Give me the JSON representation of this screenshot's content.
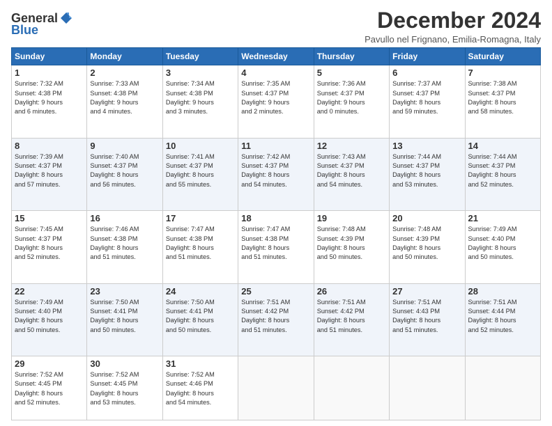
{
  "logo": {
    "general": "General",
    "blue": "Blue"
  },
  "title": "December 2024",
  "subtitle": "Pavullo nel Frignano, Emilia-Romagna, Italy",
  "headers": [
    "Sunday",
    "Monday",
    "Tuesday",
    "Wednesday",
    "Thursday",
    "Friday",
    "Saturday"
  ],
  "weeks": [
    [
      {
        "day": "1",
        "info": "Sunrise: 7:32 AM\nSunset: 4:38 PM\nDaylight: 9 hours\nand 6 minutes."
      },
      {
        "day": "2",
        "info": "Sunrise: 7:33 AM\nSunset: 4:38 PM\nDaylight: 9 hours\nand 4 minutes."
      },
      {
        "day": "3",
        "info": "Sunrise: 7:34 AM\nSunset: 4:38 PM\nDaylight: 9 hours\nand 3 minutes."
      },
      {
        "day": "4",
        "info": "Sunrise: 7:35 AM\nSunset: 4:37 PM\nDaylight: 9 hours\nand 2 minutes."
      },
      {
        "day": "5",
        "info": "Sunrise: 7:36 AM\nSunset: 4:37 PM\nDaylight: 9 hours\nand 0 minutes."
      },
      {
        "day": "6",
        "info": "Sunrise: 7:37 AM\nSunset: 4:37 PM\nDaylight: 8 hours\nand 59 minutes."
      },
      {
        "day": "7",
        "info": "Sunrise: 7:38 AM\nSunset: 4:37 PM\nDaylight: 8 hours\nand 58 minutes."
      }
    ],
    [
      {
        "day": "8",
        "info": "Sunrise: 7:39 AM\nSunset: 4:37 PM\nDaylight: 8 hours\nand 57 minutes."
      },
      {
        "day": "9",
        "info": "Sunrise: 7:40 AM\nSunset: 4:37 PM\nDaylight: 8 hours\nand 56 minutes."
      },
      {
        "day": "10",
        "info": "Sunrise: 7:41 AM\nSunset: 4:37 PM\nDaylight: 8 hours\nand 55 minutes."
      },
      {
        "day": "11",
        "info": "Sunrise: 7:42 AM\nSunset: 4:37 PM\nDaylight: 8 hours\nand 54 minutes."
      },
      {
        "day": "12",
        "info": "Sunrise: 7:43 AM\nSunset: 4:37 PM\nDaylight: 8 hours\nand 54 minutes."
      },
      {
        "day": "13",
        "info": "Sunrise: 7:44 AM\nSunset: 4:37 PM\nDaylight: 8 hours\nand 53 minutes."
      },
      {
        "day": "14",
        "info": "Sunrise: 7:44 AM\nSunset: 4:37 PM\nDaylight: 8 hours\nand 52 minutes."
      }
    ],
    [
      {
        "day": "15",
        "info": "Sunrise: 7:45 AM\nSunset: 4:37 PM\nDaylight: 8 hours\nand 52 minutes."
      },
      {
        "day": "16",
        "info": "Sunrise: 7:46 AM\nSunset: 4:38 PM\nDaylight: 8 hours\nand 51 minutes."
      },
      {
        "day": "17",
        "info": "Sunrise: 7:47 AM\nSunset: 4:38 PM\nDaylight: 8 hours\nand 51 minutes."
      },
      {
        "day": "18",
        "info": "Sunrise: 7:47 AM\nSunset: 4:38 PM\nDaylight: 8 hours\nand 51 minutes."
      },
      {
        "day": "19",
        "info": "Sunrise: 7:48 AM\nSunset: 4:39 PM\nDaylight: 8 hours\nand 50 minutes."
      },
      {
        "day": "20",
        "info": "Sunrise: 7:48 AM\nSunset: 4:39 PM\nDaylight: 8 hours\nand 50 minutes."
      },
      {
        "day": "21",
        "info": "Sunrise: 7:49 AM\nSunset: 4:40 PM\nDaylight: 8 hours\nand 50 minutes."
      }
    ],
    [
      {
        "day": "22",
        "info": "Sunrise: 7:49 AM\nSunset: 4:40 PM\nDaylight: 8 hours\nand 50 minutes."
      },
      {
        "day": "23",
        "info": "Sunrise: 7:50 AM\nSunset: 4:41 PM\nDaylight: 8 hours\nand 50 minutes."
      },
      {
        "day": "24",
        "info": "Sunrise: 7:50 AM\nSunset: 4:41 PM\nDaylight: 8 hours\nand 50 minutes."
      },
      {
        "day": "25",
        "info": "Sunrise: 7:51 AM\nSunset: 4:42 PM\nDaylight: 8 hours\nand 51 minutes."
      },
      {
        "day": "26",
        "info": "Sunrise: 7:51 AM\nSunset: 4:42 PM\nDaylight: 8 hours\nand 51 minutes."
      },
      {
        "day": "27",
        "info": "Sunrise: 7:51 AM\nSunset: 4:43 PM\nDaylight: 8 hours\nand 51 minutes."
      },
      {
        "day": "28",
        "info": "Sunrise: 7:51 AM\nSunset: 4:44 PM\nDaylight: 8 hours\nand 52 minutes."
      }
    ],
    [
      {
        "day": "29",
        "info": "Sunrise: 7:52 AM\nSunset: 4:45 PM\nDaylight: 8 hours\nand 52 minutes."
      },
      {
        "day": "30",
        "info": "Sunrise: 7:52 AM\nSunset: 4:45 PM\nDaylight: 8 hours\nand 53 minutes."
      },
      {
        "day": "31",
        "info": "Sunrise: 7:52 AM\nSunset: 4:46 PM\nDaylight: 8 hours\nand 54 minutes."
      },
      {
        "day": "",
        "info": ""
      },
      {
        "day": "",
        "info": ""
      },
      {
        "day": "",
        "info": ""
      },
      {
        "day": "",
        "info": ""
      }
    ]
  ]
}
